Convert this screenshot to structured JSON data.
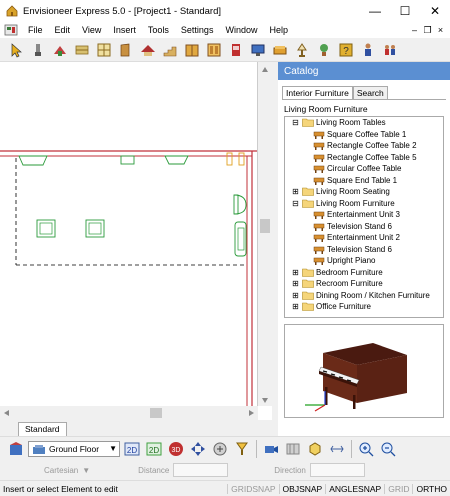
{
  "window": {
    "title": "Envisioneer Express 5.0 - [Project1 - Standard]"
  },
  "menu": [
    "File",
    "Edit",
    "View",
    "Insert",
    "Tools",
    "Settings",
    "Window",
    "Help"
  ],
  "catalog": {
    "header": "Catalog",
    "tabs": [
      "Interior Furniture",
      "Search"
    ],
    "section_label": "Living Room Furniture",
    "tree": [
      {
        "label": "Living Room Tables",
        "level": 0,
        "expanded": true
      },
      {
        "label": "Square Coffee Table 1",
        "level": 1
      },
      {
        "label": "Rectangle Coffee Table 2",
        "level": 1
      },
      {
        "label": "Rectangle Coffee Table 5",
        "level": 1
      },
      {
        "label": "Circular Coffee Table",
        "level": 1
      },
      {
        "label": "Square End Table 1",
        "level": 1
      },
      {
        "label": "Living Room Seating",
        "level": 0,
        "expanded": false
      },
      {
        "label": "Living Room Furniture",
        "level": 0,
        "expanded": true
      },
      {
        "label": "Entertainment Unit 3",
        "level": 1
      },
      {
        "label": "Television Stand 6",
        "level": 1
      },
      {
        "label": "Entertainment Unit 2",
        "level": 1
      },
      {
        "label": "Television Stand 6",
        "level": 1
      },
      {
        "label": "Upright Piano",
        "level": 1
      },
      {
        "label": "Bedroom Furniture",
        "level": 0,
        "expanded": false
      },
      {
        "label": "Recroom Furniture",
        "level": 0,
        "expanded": false
      },
      {
        "label": "Dining Room / Kitchen Furniture",
        "level": 0,
        "expanded": false
      },
      {
        "label": "Office Furniture",
        "level": 0,
        "expanded": false
      }
    ]
  },
  "document_tab": "Standard",
  "floor": {
    "selected": "Ground Floor"
  },
  "coords": {
    "mode": "Cartesian",
    "distance_label": "Distance",
    "direction_label": "Direction"
  },
  "status": {
    "message": "Insert or select Element to edit",
    "flags": [
      "GRIDSNAP",
      "OBJSNAP",
      "ANGLESNAP",
      "GRID",
      "ORTHO"
    ],
    "flags_active": [
      false,
      true,
      true,
      false,
      true
    ]
  },
  "colors": {
    "accent": "#5b8fd2",
    "wall": "#c0303a",
    "furniture": "#2a9a3a"
  }
}
